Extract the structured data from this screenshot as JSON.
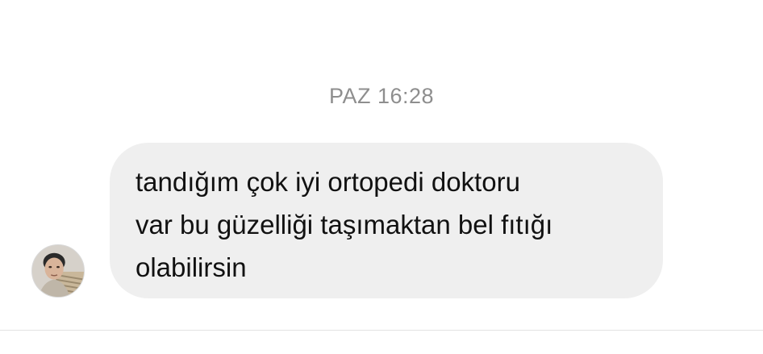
{
  "conversation": {
    "timestamp": "PAZ 16:28",
    "messages": [
      {
        "sender_avatar": "profile-photo",
        "text": "tandığım çok iyi ortopedi doktoru\nvar bu güzelliği taşımaktan bel fıtığı\nolabilirsin"
      }
    ]
  },
  "colors": {
    "background": "#ffffff",
    "bubble": "#efefef",
    "timestamp_text": "#8e8e8e",
    "message_text": "#111111"
  }
}
